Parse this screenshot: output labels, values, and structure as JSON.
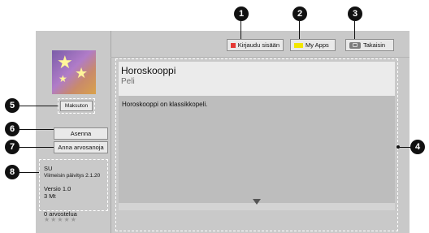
{
  "topbar": {
    "login_label": "Kirjaudu sisään",
    "login_color": "#e53935",
    "myapps_label": "My Apps",
    "myapps_color": "#f2e600",
    "back_label": "Takaisin"
  },
  "sidebar": {
    "price_label": "Maksuton",
    "install_label": "Asenna",
    "rate_label": "Anna arvosanoja",
    "info": {
      "publisher": "SU",
      "updated": "Viimeisin päivitys 2.1.20",
      "version": "Versio 1.0",
      "size": "3 Mt",
      "ratings": "0 arvostelua",
      "stars": "★★★★★"
    }
  },
  "content": {
    "title": "Horoskooppi",
    "subtitle": "Peli",
    "description": "Horoskooppi on klassikkopeli."
  },
  "callouts": [
    "1",
    "2",
    "3",
    "4",
    "5",
    "6",
    "7",
    "8"
  ],
  "icons": {
    "thumbnail": "app-thumbnail-stars",
    "back": "back-remote-icon",
    "scroll": "scroll-down-arrow-icon"
  }
}
